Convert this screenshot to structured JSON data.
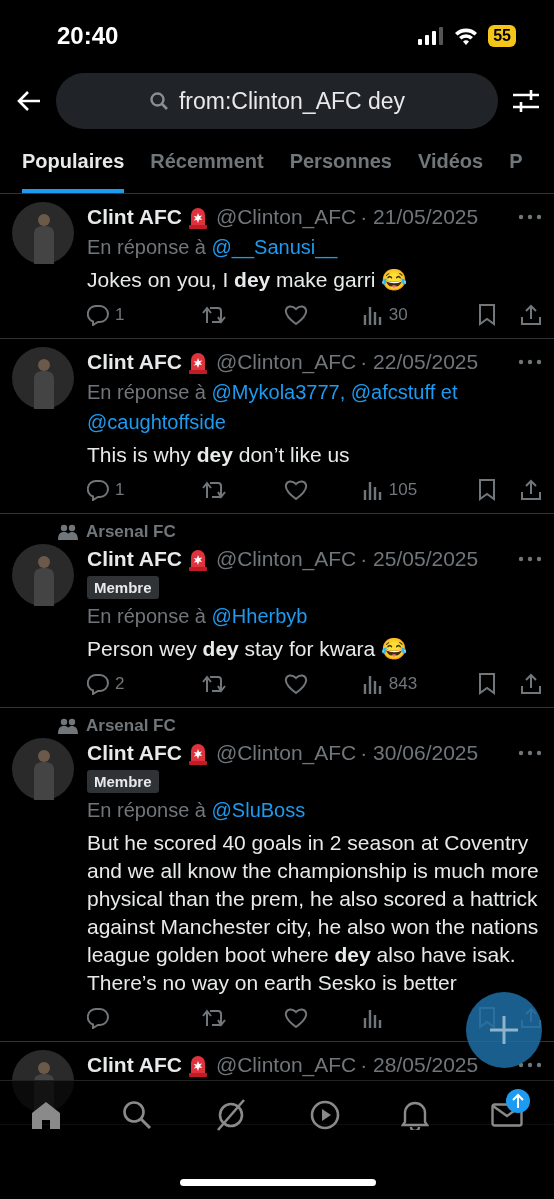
{
  "status_bar": {
    "time": "20:40",
    "battery": "55"
  },
  "search": {
    "value": "from:Clinton_AFC dey"
  },
  "tabs": [
    {
      "label": "Populaires",
      "selected": true
    },
    {
      "label": "Récemment",
      "selected": false
    },
    {
      "label": "Personnes",
      "selected": false
    },
    {
      "label": "Vidéos",
      "selected": false
    },
    {
      "label": "P",
      "selected": false
    }
  ],
  "tweets": [
    {
      "name": "Clint AFC",
      "handle": "@Clinton_AFC",
      "date": "· 21/05/2025",
      "reply_prefix": "En réponse à",
      "reply_to": [
        "@__Sanusi__"
      ],
      "text": "Jokes on you, I **dey** make garri 😂",
      "replies": "1",
      "views": "30"
    },
    {
      "name": "Clint AFC",
      "handle": "@Clinton_AFC",
      "date": "· 22/05/2025",
      "reply_prefix": "En réponse à",
      "reply_to": [
        "@Mykola3777,",
        "@afcstuff et",
        "@caughtoffside"
      ],
      "text": "This is why **dey** don’t like us",
      "replies": "1",
      "views": "105"
    },
    {
      "community": "Arsenal FC",
      "member_badge": "Membre",
      "name": "Clint AFC",
      "handle": "@Clinton_AFC",
      "date": "· 25/05/2025",
      "reply_prefix": "En réponse à",
      "reply_to": [
        "@Hherbyb"
      ],
      "text": "Person wey **dey** stay for kwara 😂",
      "replies": "2",
      "views": "843"
    },
    {
      "community": "Arsenal FC",
      "member_badge": "Membre",
      "name": "Clint AFC",
      "handle": "@Clinton_AFC",
      "date": "· 30/06/2025",
      "reply_prefix": "En réponse à",
      "reply_to": [
        "@SluBoss"
      ],
      "text": "But he scored 40 goals in 2 season at Coventry and we all know the championship is much more physical than the prem, he also scored a hattrick against Manchester city, he also won the nations league golden boot where **dey** also have isak. There’s no way on earth Sesko is better"
    },
    {
      "name": "Clint AFC",
      "handle": "@Clinton_AFC",
      "date": "· 28/05/2025"
    }
  ]
}
